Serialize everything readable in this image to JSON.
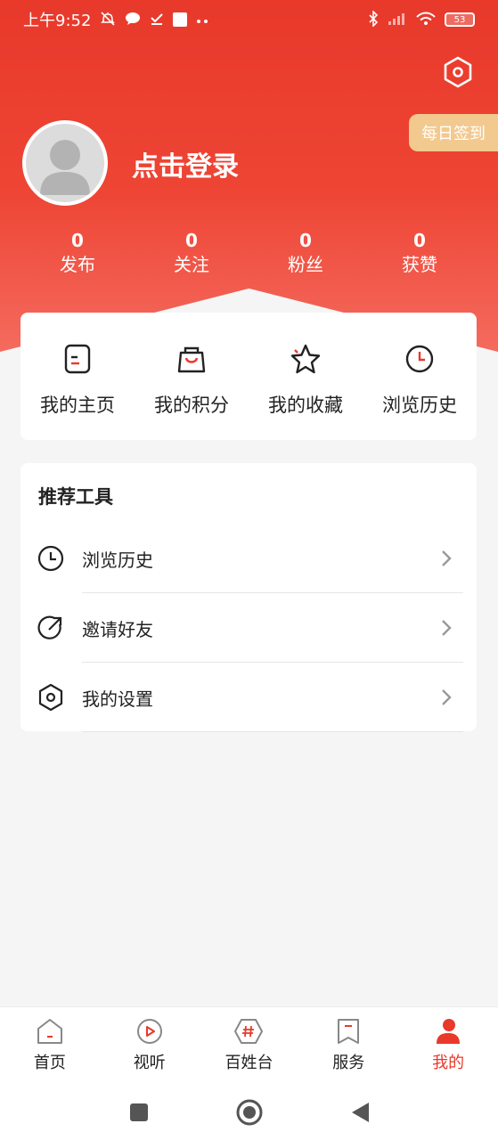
{
  "status_bar": {
    "time": "上午9:52",
    "battery": "53",
    "icons": [
      "mute-icon",
      "message-icon",
      "check-icon",
      "square-icon",
      "more-dots-icon",
      "bluetooth-icon",
      "signal-icon",
      "wifi-icon",
      "battery-icon"
    ]
  },
  "header": {
    "login_label": "点击登录",
    "checkin_label": "每日签到",
    "settings_icon": "hexagon-settings-icon"
  },
  "stats": [
    {
      "value": "0",
      "label": "发布"
    },
    {
      "value": "0",
      "label": "关注"
    },
    {
      "value": "0",
      "label": "粉丝"
    },
    {
      "value": "0",
      "label": "获赞"
    }
  ],
  "quick_actions": [
    {
      "label": "我的主页",
      "icon": "profile-page-icon"
    },
    {
      "label": "我的积分",
      "icon": "shopping-bag-icon"
    },
    {
      "label": "我的收藏",
      "icon": "star-icon"
    },
    {
      "label": "浏览历史",
      "icon": "clock-icon"
    }
  ],
  "tools": {
    "title": "推荐工具",
    "items": [
      {
        "label": "浏览历史",
        "icon": "clock-icon"
      },
      {
        "label": "邀请好友",
        "icon": "share-arrow-icon"
      },
      {
        "label": "我的设置",
        "icon": "hexagon-settings-icon"
      }
    ]
  },
  "tab_bar": [
    {
      "label": "首页",
      "icon": "home-icon",
      "active": false
    },
    {
      "label": "视听",
      "icon": "play-icon",
      "active": false
    },
    {
      "label": "百姓台",
      "icon": "hashtag-icon",
      "active": false
    },
    {
      "label": "服务",
      "icon": "bookmark-icon",
      "active": false
    },
    {
      "label": "我的",
      "icon": "user-icon",
      "active": true
    }
  ],
  "colors": {
    "brand_red": "#e8392b",
    "checkin_gold": "#f2c98f",
    "page_bg": "#f5f5f5"
  }
}
